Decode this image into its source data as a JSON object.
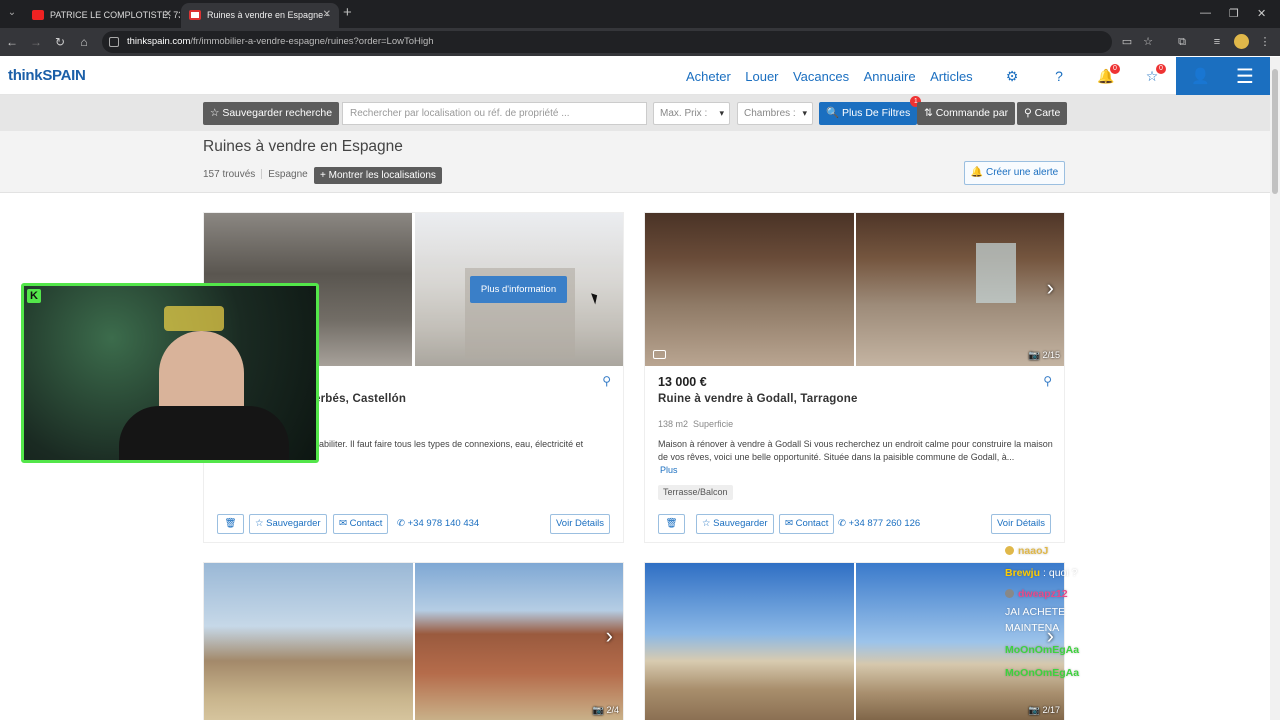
{
  "browser": {
    "tabs": [
      {
        "title": "PATRICE LE COMPLOTISTE, 73 /"
      },
      {
        "title": "Ruines à vendre en Espagne - "
      }
    ],
    "url_host": "thinkspain.com",
    "url_path": "/fr/immobilier-a-vendre-espagne/ruines?order=LowToHigh"
  },
  "site": {
    "logo_think": "think",
    "logo_spain": "SPAIN",
    "nav": [
      "Acheter",
      "Louer",
      "Vacances",
      "Annuaire",
      "Articles"
    ],
    "notif_count": "0",
    "fav_count": "0",
    "brand_color": "#1b6fc0"
  },
  "filters": {
    "save_search": "Sauvegarder recherche",
    "search_placeholder": "Rechercher par localisation ou réf. de propriété ...",
    "max_price": "Max. Prix :",
    "bedrooms": "Chambres :",
    "more_filters": "Plus De Filtres",
    "more_filters_badge": "1",
    "sort": "Commande par",
    "map": "Carte"
  },
  "results": {
    "title": "Ruines à vendre en Espagne",
    "count": "157 trouvés",
    "region": "Espagne",
    "show_locations": "Montrer les localisations",
    "create_alert": "Créer une alerte"
  },
  "listings": [
    {
      "title_partial": "erbés, Castellón",
      "desc_partial": "nabiliter. Il faut faire tous les types de connexions, eau, électricité et",
      "more_info": "Plus d'information",
      "save": "Sauvegarder",
      "contact": "Contact",
      "phone": "+34 978 140 434",
      "details": "Voir Détails"
    },
    {
      "price": "13 000 €",
      "title": "Ruine à vendre à Godall, Tarragone",
      "area_value": "138 m2",
      "area_label": "Superficie",
      "desc": "Maison à rénover à vendre à Godall Si vous recherchez un endroit calme pour construire la maison de vos rêves, voici une belle opportunité. Située dans la paisible commune de Godall, à...",
      "more": "Plus",
      "tag": "Terrasse/Balcon",
      "photo_count": "2/15",
      "save": "Sauvegarder",
      "contact": "Contact",
      "phone": "+34 877 260 126",
      "details": "Voir Détails"
    },
    {
      "photo_count": "2/4"
    },
    {
      "photo_count": "2/17"
    }
  ],
  "chat": [
    {
      "user": "naaoJ",
      "msg": "",
      "color": "#e0b84a"
    },
    {
      "user": "Brewju",
      "msg": ": quoi ?",
      "color": "#ffcc00"
    },
    {
      "user": "dweapz12",
      "msg": "",
      "color": "#e94a8a"
    },
    {
      "user": "",
      "msg": "JAI ACHETE",
      "color": "#ffffff"
    },
    {
      "user": "",
      "msg": "MAINTENA",
      "color": "#ffffff"
    },
    {
      "user": "MoOnOmEgAa",
      "msg": "",
      "color": "#3ed23e"
    },
    {
      "user": "MoOnOmEgAa",
      "msg": "",
      "color": "#3ed23e"
    }
  ],
  "icons": {
    "star": "☆",
    "bell": "🔔",
    "pin": "⚲",
    "phone": "✆",
    "camera": "📷"
  }
}
